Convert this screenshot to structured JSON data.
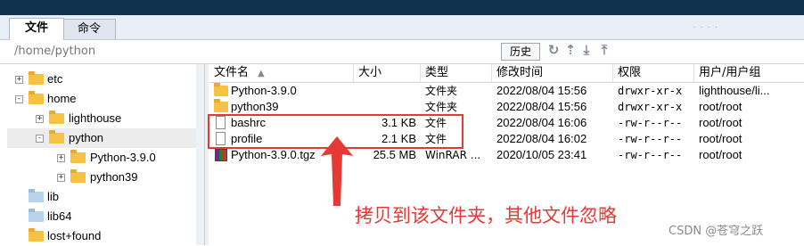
{
  "tabs": [
    {
      "label": "文件",
      "active": true
    },
    {
      "label": "命令",
      "active": false
    }
  ],
  "path_bar": {
    "path": "/home/python",
    "history_label": "历史",
    "icons": [
      "refresh-icon",
      "up-icon",
      "download-icon",
      "upload-icon"
    ]
  },
  "tree": [
    {
      "label": "etc",
      "icon": "folder-icon",
      "expander": "+"
    },
    {
      "label": "home",
      "icon": "folder-icon",
      "expander": "-"
    },
    {
      "label": "lighthouse",
      "icon": "folder-icon",
      "expander": "+"
    },
    {
      "label": "python",
      "icon": "folder-icon",
      "expander": "-",
      "selected": true
    },
    {
      "label": "Python-3.9.0",
      "icon": "folder-icon",
      "expander": "+"
    },
    {
      "label": "python39",
      "icon": "folder-icon",
      "expander": "+"
    },
    {
      "label": "lib",
      "icon": "folder-link-icon"
    },
    {
      "label": "lib64",
      "icon": "folder-link-icon"
    },
    {
      "label": "lost+found",
      "icon": "folder-icon"
    }
  ],
  "file_list": {
    "columns": {
      "name": "文件名",
      "size": "大小",
      "type": "类型",
      "mtime": "修改时间",
      "perm": "权限",
      "owner": "用户/用户组"
    },
    "rows": [
      {
        "name": "Python-3.9.0",
        "size": "",
        "type": "文件夹",
        "mtime": "2022/08/04 15:56",
        "perm": "drwxr-xr-x",
        "owner": "lighthouse/li...",
        "icon": "folder-icon"
      },
      {
        "name": "python39",
        "size": "",
        "type": "文件夹",
        "mtime": "2022/08/04 15:56",
        "perm": "drwxr-xr-x",
        "owner": "root/root",
        "icon": "folder-icon"
      },
      {
        "name": "bashrc",
        "size": "3.1 KB",
        "type": "文件",
        "mtime": "2022/08/04 16:06",
        "perm": "-rw-r--r--",
        "owner": "root/root",
        "icon": "file-icon"
      },
      {
        "name": "profile",
        "size": "2.1 KB",
        "type": "文件",
        "mtime": "2022/08/04 16:02",
        "perm": "-rw-r--r--",
        "owner": "root/root",
        "icon": "file-icon"
      },
      {
        "name": "Python-3.9.0.tgz",
        "size": "25.5 MB",
        "type": "WinRAR ...",
        "mtime": "2020/10/05 23:41",
        "perm": "-rw-r--r--",
        "owner": "root/root",
        "icon": "archive-icon"
      }
    ]
  },
  "annotation": {
    "text": "拷贝到该文件夹，其他文件忽略",
    "color": "#e53935"
  },
  "watermark": "CSDN @苍穹之跃",
  "colors": {
    "title_bar": "#10324e",
    "selection": "#ececec",
    "folder": "#f5c242",
    "annotation_red": "#e53935"
  }
}
